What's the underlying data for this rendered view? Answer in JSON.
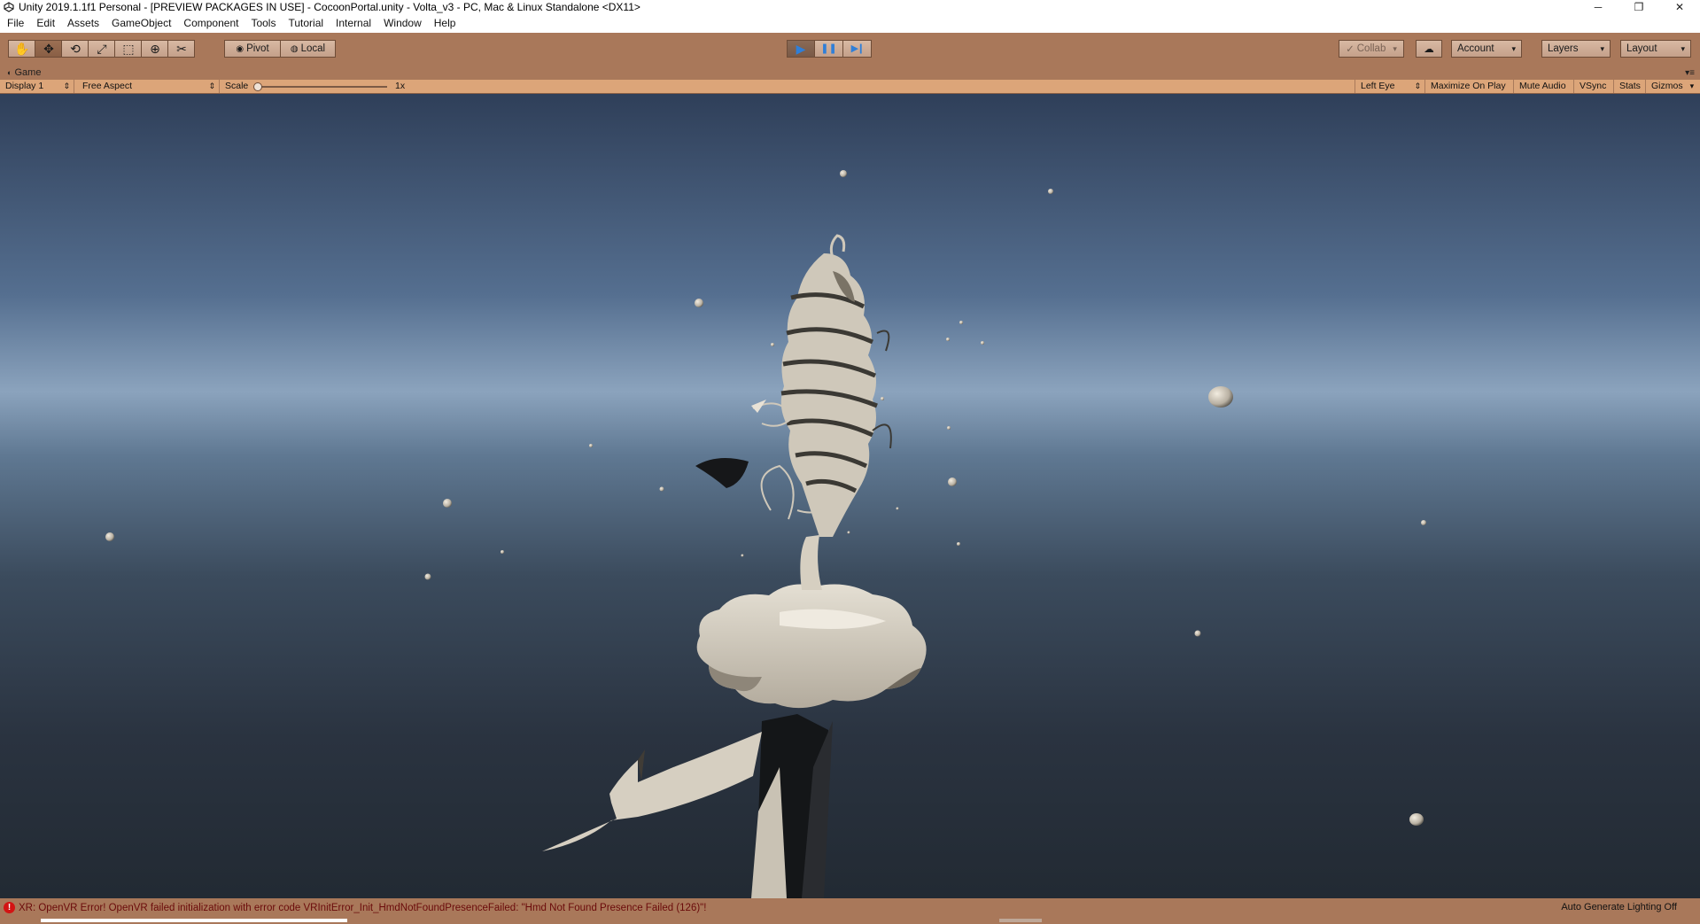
{
  "window": {
    "title": "Unity 2019.1.1f1 Personal - [PREVIEW PACKAGES IN USE] - CocoonPortal.unity - Volta_v3 - PC, Mac & Linux Standalone <DX11>",
    "controls": {
      "minimize": "─",
      "restore": "❐",
      "close": "✕"
    }
  },
  "menu": [
    "File",
    "Edit",
    "Assets",
    "GameObject",
    "Component",
    "Tools",
    "Tutorial",
    "Internal",
    "Window",
    "Help"
  ],
  "toolbar": {
    "tools": [
      {
        "name": "hand-tool",
        "icon": "hand-icon",
        "glyph": "✋"
      },
      {
        "name": "move-tool",
        "icon": "move-icon",
        "glyph": "✥"
      },
      {
        "name": "rotate-tool",
        "icon": "rotate-icon",
        "glyph": "⟲"
      },
      {
        "name": "scale-tool",
        "icon": "scale-icon",
        "glyph": "⤢"
      },
      {
        "name": "rect-tool",
        "icon": "rect-icon",
        "glyph": "⬚"
      },
      {
        "name": "transform-tool",
        "icon": "transform-icon",
        "glyph": "⊕"
      },
      {
        "name": "custom-tool",
        "icon": "custom-tool-icon",
        "glyph": "✂"
      }
    ],
    "pivot_label": "Pivot",
    "local_label": "Local",
    "play_glyph": "▶",
    "pause_glyph": "❚❚",
    "step_glyph": "▶❙",
    "collab_label": "Collab",
    "account_label": "Account",
    "layers_label": "Layers",
    "layout_label": "Layout"
  },
  "game_tab": {
    "label": "Game"
  },
  "game_bar": {
    "display": "Display 1",
    "aspect": "Free Aspect",
    "scale_label": "Scale",
    "scale_value": "1x",
    "eye": "Left Eye",
    "maximize": "Maximize On Play",
    "mute": "Mute Audio",
    "vsync": "VSync",
    "stats": "Stats",
    "gizmos": "Gizmos"
  },
  "status": {
    "message": "XR: OpenVR Error! OpenVR failed initialization with error code VRInitError_Init_HmdNotFoundPresenceFailed: \"Hmd Not Found Presence Failed (126)\"!",
    "right": "Auto Generate Lighting Off"
  },
  "colors": {
    "toolbar": "#a9785a",
    "gamebar": "#dca579",
    "play_accent": "#2f7fd8",
    "error": "#d31313"
  }
}
